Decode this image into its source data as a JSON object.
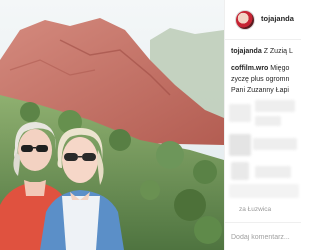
{
  "post": {
    "username": "tojajanda",
    "caption": {
      "author": "tojajanda",
      "text": "Z Zuzią L"
    },
    "comment": {
      "author": "coffilm.wro",
      "line1": "Mięgo",
      "line2": "zyczę plus ogromn",
      "line3": "Pani Zuzanny Łapi"
    },
    "location": "za Łuzwica",
    "comment_placeholder": "Dodaj komentarz..."
  },
  "colors": {
    "sky": "#e9f1f4",
    "rock": "#c4695e",
    "foliage": "#6a8c52",
    "shirt_red": "#e0523f",
    "shirt_blue": "#5b8fc8"
  },
  "icons": {
    "avatar": "profile-avatar"
  }
}
